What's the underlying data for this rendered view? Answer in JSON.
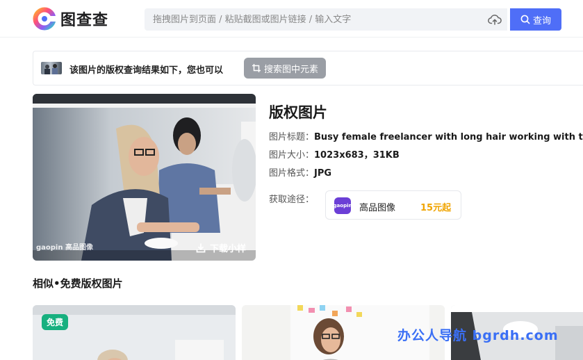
{
  "header": {
    "logo_text": "图查查",
    "search_placeholder": "拖拽图片到页面 / 粘贴截图或图片链接 / 输入文字",
    "search_button": "查询",
    "accent_color": "#4f6ef7"
  },
  "result_bar": {
    "text": "该图片的版权查询结果如下，您也可以",
    "element_button": "搜索图中元素"
  },
  "main_image": {
    "watermark": "gaopin 高品图像",
    "download_label": "下载小样"
  },
  "info": {
    "title": "版权图片",
    "rows": [
      {
        "label": "图片标题：",
        "value": "Busy female freelancer with long hair working with tal"
      },
      {
        "label": "图片大小：",
        "value": "1023x683，31KB"
      },
      {
        "label": "图片格式：",
        "value": "JPG"
      }
    ],
    "obtain_label": "获取途径：",
    "source": {
      "logo_text": "gaopin",
      "name": "高品图像",
      "price": "15元起",
      "price_color": "#f0a400"
    }
  },
  "similar": {
    "title": "相似•免费版权图片",
    "badge": "免费",
    "badge_color": "#17b07f"
  },
  "overlay_watermark": "办公人导航 bgrdh.com"
}
